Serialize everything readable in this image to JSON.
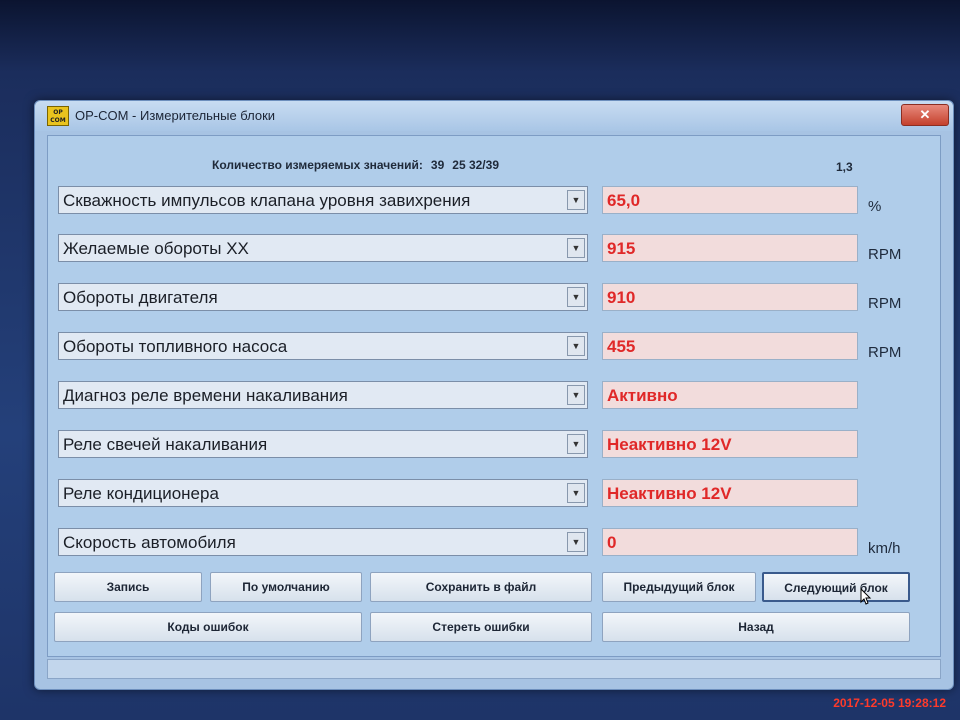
{
  "window": {
    "title": "OP-COM - Измерительные блоки",
    "icon_text": "OP COM",
    "close_label": "✕"
  },
  "header": {
    "count_label": "Количество измеряемых значений:",
    "count_value": "39",
    "range": "25 32/39",
    "page": "1,3"
  },
  "rows": [
    {
      "label": "Скважность импульсов клапана уровня завихрения",
      "value": "65,0",
      "unit": "%"
    },
    {
      "label": "Желаемые обороты ХХ",
      "value": "915",
      "unit": "RPM"
    },
    {
      "label": "Обороты двигателя",
      "value": "910",
      "unit": "RPM"
    },
    {
      "label": "Обороты топливного насоса",
      "value": "455",
      "unit": "RPM"
    },
    {
      "label": "Диагноз реле времени накаливания",
      "value": "Активно",
      "unit": ""
    },
    {
      "label": "Реле свечей накаливания",
      "value": "Неактивно 12V",
      "unit": ""
    },
    {
      "label": "Реле кондиционера",
      "value": "Неактивно 12V",
      "unit": ""
    },
    {
      "label": "Скорость автомобиля",
      "value": "0",
      "unit": "km/h"
    }
  ],
  "buttons": {
    "record": "Запись",
    "default": "По умолчанию",
    "save_file": "Сохранить в файл",
    "prev_block": "Предыдущий блок",
    "next_block": "Следующий блок",
    "error_codes": "Коды ошибок",
    "clear_errors": "Стереть ошибки",
    "back": "Назад"
  },
  "timestamp": "2017-12-05 19:28:12",
  "colors": {
    "value_text": "#e02828",
    "window_bg": "#a7c3e3",
    "timestamp": "#ff3a2a"
  }
}
